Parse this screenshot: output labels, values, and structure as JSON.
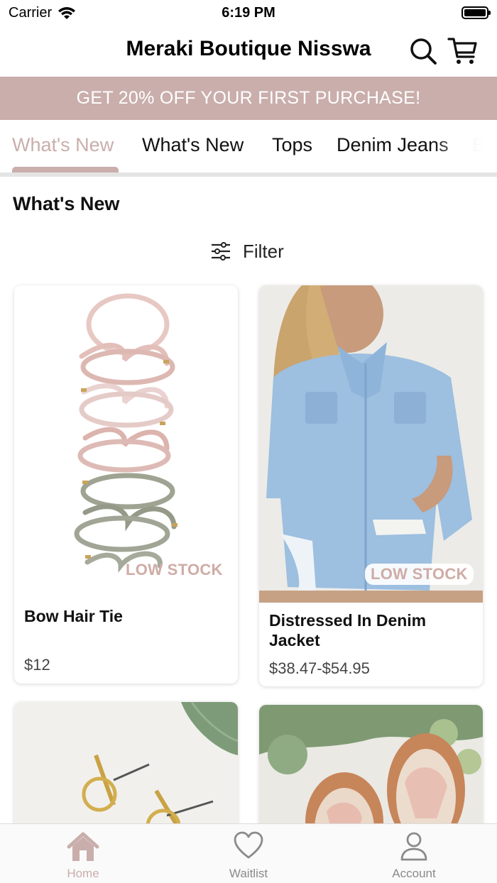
{
  "status_bar": {
    "carrier": "Carrier",
    "time": "6:19 PM"
  },
  "header": {
    "title": "Meraki Boutique Nisswa",
    "search_icon": "search-icon",
    "cart_icon": "cart-icon"
  },
  "promo": {
    "text": "GET 20% OFF YOUR FIRST PURCHASE!"
  },
  "category_tabs": [
    {
      "label": "What's New",
      "active": true
    },
    {
      "label": "What's New",
      "active": false
    },
    {
      "label": "Tops",
      "active": false
    },
    {
      "label": "Denim Jeans",
      "active": false
    },
    {
      "label": "B",
      "active": false
    }
  ],
  "section": {
    "title": "What's New"
  },
  "filter": {
    "label": "Filter",
    "icon": "sliders-icon"
  },
  "products": [
    {
      "name": "Bow Hair Tie",
      "price": "$12",
      "badge": "LOW STOCK"
    },
    {
      "name": "Distressed In Denim Jacket",
      "price": "$38.47-$54.95",
      "badge": "LOW STOCK"
    },
    {
      "name": "",
      "price": "",
      "badge": ""
    },
    {
      "name": "",
      "price": "",
      "badge": ""
    }
  ],
  "tabbar": [
    {
      "label": "Home",
      "icon": "home-icon",
      "active": true
    },
    {
      "label": "Waitlist",
      "icon": "heart-icon",
      "active": false
    },
    {
      "label": "Account",
      "icon": "person-icon",
      "active": false
    }
  ],
  "colors": {
    "accent": "#c9aeab",
    "badge": "#cfaca6"
  }
}
